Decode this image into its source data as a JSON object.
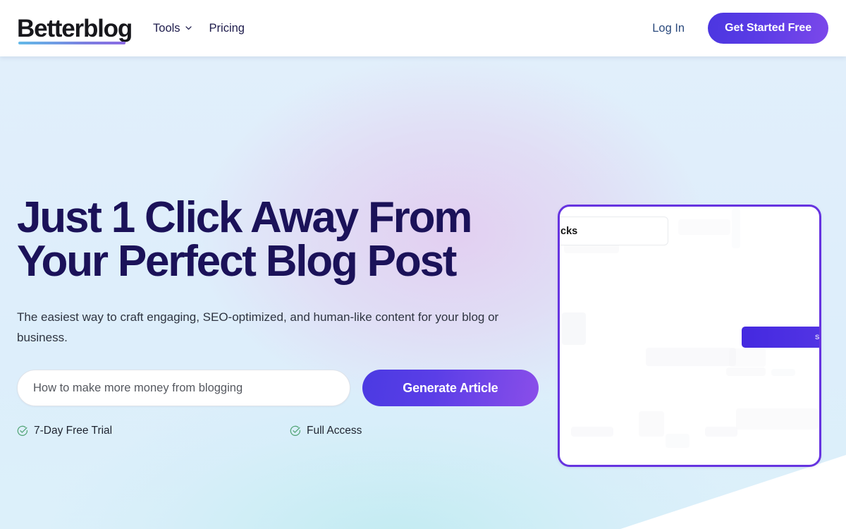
{
  "header": {
    "brand": "Betterblog",
    "nav": [
      {
        "label": "Tools",
        "has_dropdown": true,
        "icon": "chevron-down-icon"
      },
      {
        "label": "Pricing",
        "has_dropdown": false
      }
    ],
    "login_label": "Log In",
    "cta_label": "Get Started Free"
  },
  "hero": {
    "headline_line1": "Just 1 Click Away From",
    "headline_line2": "Your Perfect Blog Post",
    "subhead": "The easiest way to craft engaging, SEO-optimized, and human-like content for your blog or business.",
    "input_value": "How to make more money from blogging",
    "input_placeholder": "How to make more money from blogging",
    "generate_label": "Generate Article",
    "badges": [
      {
        "label": "7-Day Free Trial",
        "icon": "circle-check-icon"
      },
      {
        "label": "Full Access",
        "icon": "circle-check-icon"
      }
    ]
  },
  "preview": {
    "clipped_title": "cks",
    "clipped_button": "Sub"
  },
  "colors": {
    "brand_text": "#17171c",
    "nav_text": "#1d1b4b",
    "login_text": "#2b4a7d",
    "cta_gradient_start": "#4b36e0",
    "cta_gradient_end": "#7c48ea",
    "headline": "#1b1259",
    "subhead": "#2e3440",
    "generate_gradient_start": "#4b3ae2",
    "generate_gradient_end": "#8a4ee9",
    "card_border": "#6633e0",
    "check_green": "#4fa373",
    "hero_bg_blue": "#e1effb",
    "hero_bg_lavender": "#e2cdf0",
    "logo_underline_start": "#63b9e8",
    "logo_underline_end": "#8b6ae4"
  }
}
